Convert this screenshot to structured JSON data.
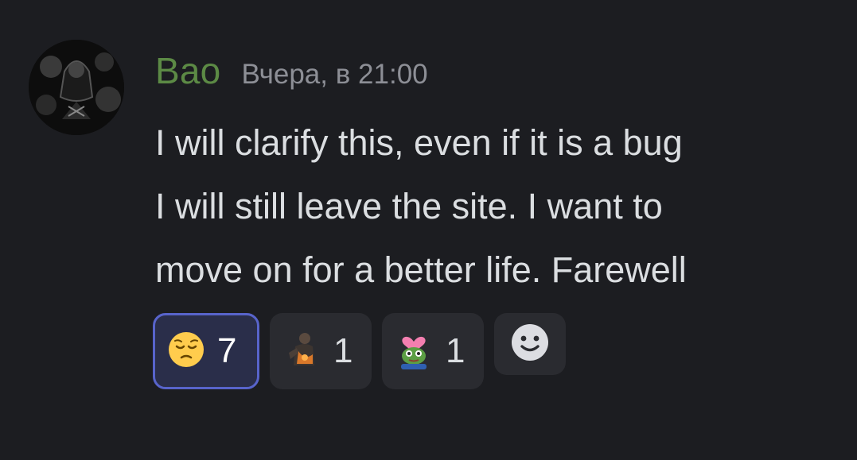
{
  "message": {
    "author": "Bao",
    "timestamp": "Вчера, в 21:00",
    "lines": [
      "I will clarify this, even if it is a bug",
      "I will still leave the site. I want to",
      "move on for a better life. Farewell"
    ]
  },
  "reactions": [
    {
      "emoji": "pensive-face-emoji",
      "count": "7",
      "active": true
    },
    {
      "emoji": "custom-figure-emoji",
      "count": "1",
      "active": false
    },
    {
      "emoji": "custom-pepe-heart-emoji",
      "count": "1",
      "active": false
    }
  ],
  "add_reaction": {
    "icon": "smiley-add-reaction-icon"
  },
  "colors": {
    "background": "#1c1d21",
    "author": "#5c8a45",
    "timestamp": "#8d8f96",
    "text": "#dbdee1",
    "reaction_bg": "#2a2b30",
    "reaction_active_bg": "#2a2e4a",
    "reaction_active_border": "#5864cb"
  }
}
